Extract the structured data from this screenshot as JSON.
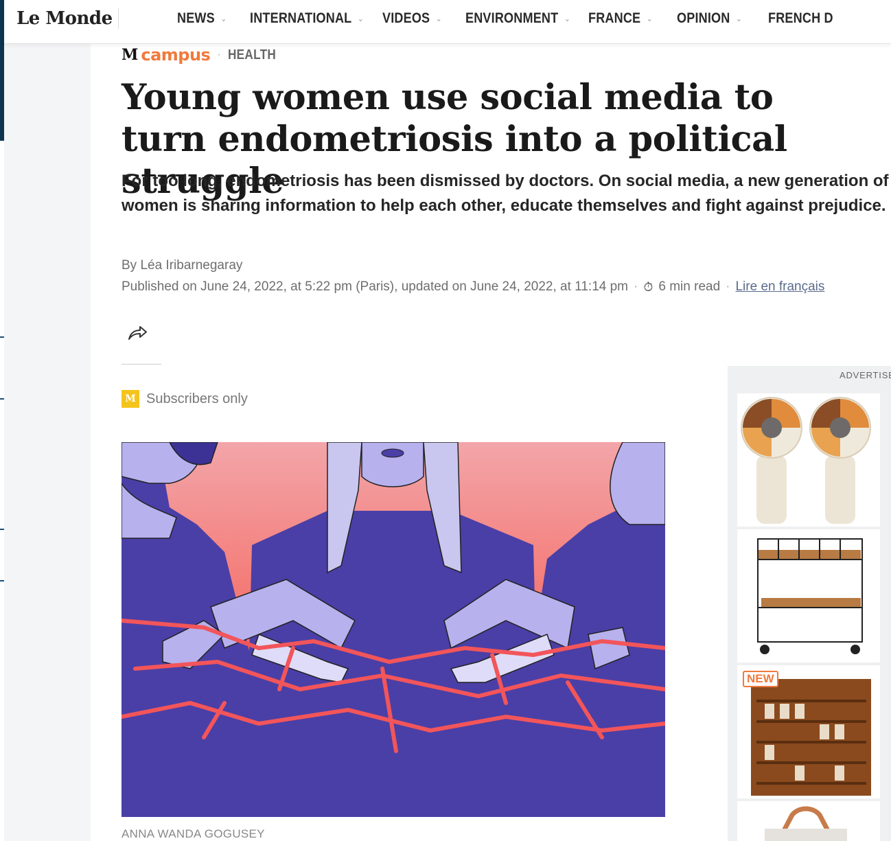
{
  "header": {
    "logo": "Le Monde",
    "nav": [
      {
        "label": "NEWS"
      },
      {
        "label": "INTERNATIONAL"
      },
      {
        "label": "VIDEOS"
      },
      {
        "label": "ENVIRONMENT"
      },
      {
        "label": "FRANCE"
      },
      {
        "label": "OPINION"
      },
      {
        "label": "FRENCH D"
      }
    ]
  },
  "article": {
    "kicker_logo": "M",
    "kicker_brand": "campus",
    "kicker_separator": "·",
    "section": "HEALTH",
    "title": "Young women use social media to turn endometriosis into a political struggle",
    "lead": "For too long, endometriosis has been dismissed by doctors. On social media, a new generation of women is sharing information to help each other, educate themselves and fight against prejudice.",
    "byline": "By Léa Iribarnegaray",
    "published": "Published on June 24, 2022, at 5:22 pm (Paris), updated on June 24, 2022, at 11:14 pm",
    "dot": "·",
    "read_time": "6 min read",
    "lire_link": "Lire en français",
    "subscribers_badge": "M",
    "subscribers_label": "Subscribers only",
    "image_credit": "ANNA WANDA GOGUSEY"
  },
  "ad": {
    "label": "ADVERTISE",
    "new_badge": "NEW"
  },
  "colors": {
    "campus_orange": "#f07a3c",
    "subscriber_yellow": "#f5c41c",
    "illustration_blue": "#4a3fa6",
    "illustration_red": "#f2555a"
  }
}
